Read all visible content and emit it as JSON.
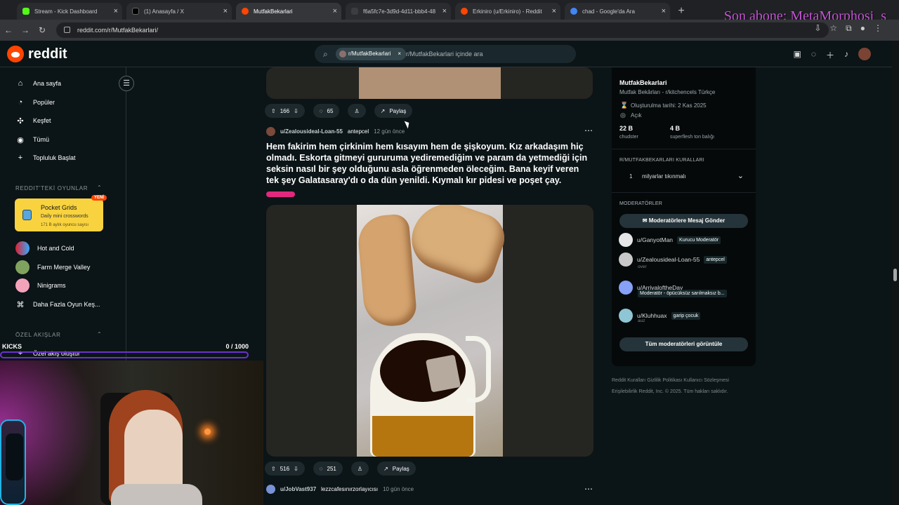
{
  "browser": {
    "tabs": [
      {
        "label": "Stream - Kick Dashboard",
        "icon": "kick-logo-icon",
        "color": "#53fc18"
      },
      {
        "label": "(1) Anasayfa / X",
        "icon": "x-logo-icon",
        "color": "#000000"
      },
      {
        "label": "MutfakBekarlari",
        "icon": "reddit-logo-icon",
        "color": "#ff4500"
      },
      {
        "label": "f6a5fc7e-3d9d-4d11-bbb4-48",
        "icon": "blank-page-icon",
        "color": "#3c3d40"
      },
      {
        "label": "Erkiniro (u/Erkiniro) - Reddit",
        "icon": "reddit-logo-icon",
        "color": "#ff4500"
      },
      {
        "label": "chad - Google'da Ara",
        "icon": "google-logo-icon",
        "color": "#4285f4"
      }
    ],
    "url": "reddit.com/r/MutfakBekarlari/",
    "overlay_text": "Son abone: MetaMorphosi_s"
  },
  "reddit": {
    "logo_text": "reddit",
    "search_chip": "r/MutfakBekarlari",
    "search_placeholder": "r/MutfakBekarlari içinde ara"
  },
  "sidebar": {
    "nav": [
      "Ana sayfa",
      "Popüler",
      "Keşfet",
      "Tümü",
      "Topluluk Başlat"
    ],
    "games_title": "REDDIT'TEKİ OYUNLAR",
    "featured_game": {
      "title": "Pocket Grids",
      "subtitle": "Daily mini crosswords",
      "users": "171 B aylık oyuncu sayısı",
      "badge": "YENİ"
    },
    "games": [
      "Hot and Cold",
      "Farm Merge Valley",
      "Ninigrams",
      "Daha Fazla Oyun Keş..."
    ],
    "feeds_title": "ÖZEL AKIŞLAR",
    "create_feed": "Özel akış oluştur"
  },
  "posts": [
    {
      "votes": "166",
      "comments": "65",
      "share": "Paylaş"
    },
    {
      "user": "u/Zealousideal-Loan-55",
      "flair": "antepcel",
      "time": "12 gün önce",
      "title": "Hem fakirim hem çirkinim hem kısayım hem de şişkoyum. Kız arkadaşım hiç olmadı. Eskorta gitmeyi gururuma yediremediğim ve param da yetmediği için seksin nasıl bir şey olduğunu asla öğrenmeden öleceğim. Bana keyif veren tek şey Galatasaray'dı o da dün yenildi. Kıymalı kır pidesi ve poşet çay.",
      "votes": "516",
      "comments": "251",
      "share": "Paylaş"
    },
    {
      "user": "u/JobVast937",
      "flair": "lezzcafesınırzorlayıcısı",
      "time": "10 gün önce"
    }
  ],
  "community": {
    "name": "MutfakBekarlari",
    "description": "Mutfak Bekârları - r/kitchencels Türkçe",
    "created": "Oluşturulma tarihi: 2 Kas 2025",
    "visibility": "Açık",
    "members_value": "22 B",
    "members_label": "chudster",
    "online_value": "4 B",
    "online_label": "superflesh ton balığı",
    "rules_title": "R/MUTFAKBEKARLARI KURALLARI",
    "rule_number": "1",
    "rule_text": "milyarlar tıkınmalı",
    "mods_title": "MODERATÖRLER",
    "message_mods": "Moderatörlere Mesaj Gönder",
    "moderators": [
      {
        "name": "u/GanyotMan",
        "flair": "Kurucu Moderatör",
        "sub": ""
      },
      {
        "name": "u/Zealousideal-Loan-55",
        "flair": "antepcel",
        "sub": "over"
      },
      {
        "name": "u/ArrivaloftheDay",
        "flair": "Moderatör - öpücüksüz sarılmaksız b...",
        "sub": ""
      },
      {
        "name": "u/Kluhhuax",
        "flair": "garip çocuk",
        "sub": "auz"
      }
    ],
    "view_all_mods": "Tüm moderatörleri görüntüle"
  },
  "footer": {
    "line1": "Reddit Kuralları   Gizlilik Politikası   Kullanıcı Sözleşmesi",
    "line2": "Erişilebilirlik   Reddit, Inc. © 2025. Tüm hakları saklıdır."
  },
  "kicks": {
    "label": "KICKS",
    "count": "0 / 1000",
    "progress": 0
  },
  "colors": {
    "reddit_orange": "#ff4500",
    "kick_purple": "#6d31d1",
    "overlay_pink": "#c255d2"
  }
}
